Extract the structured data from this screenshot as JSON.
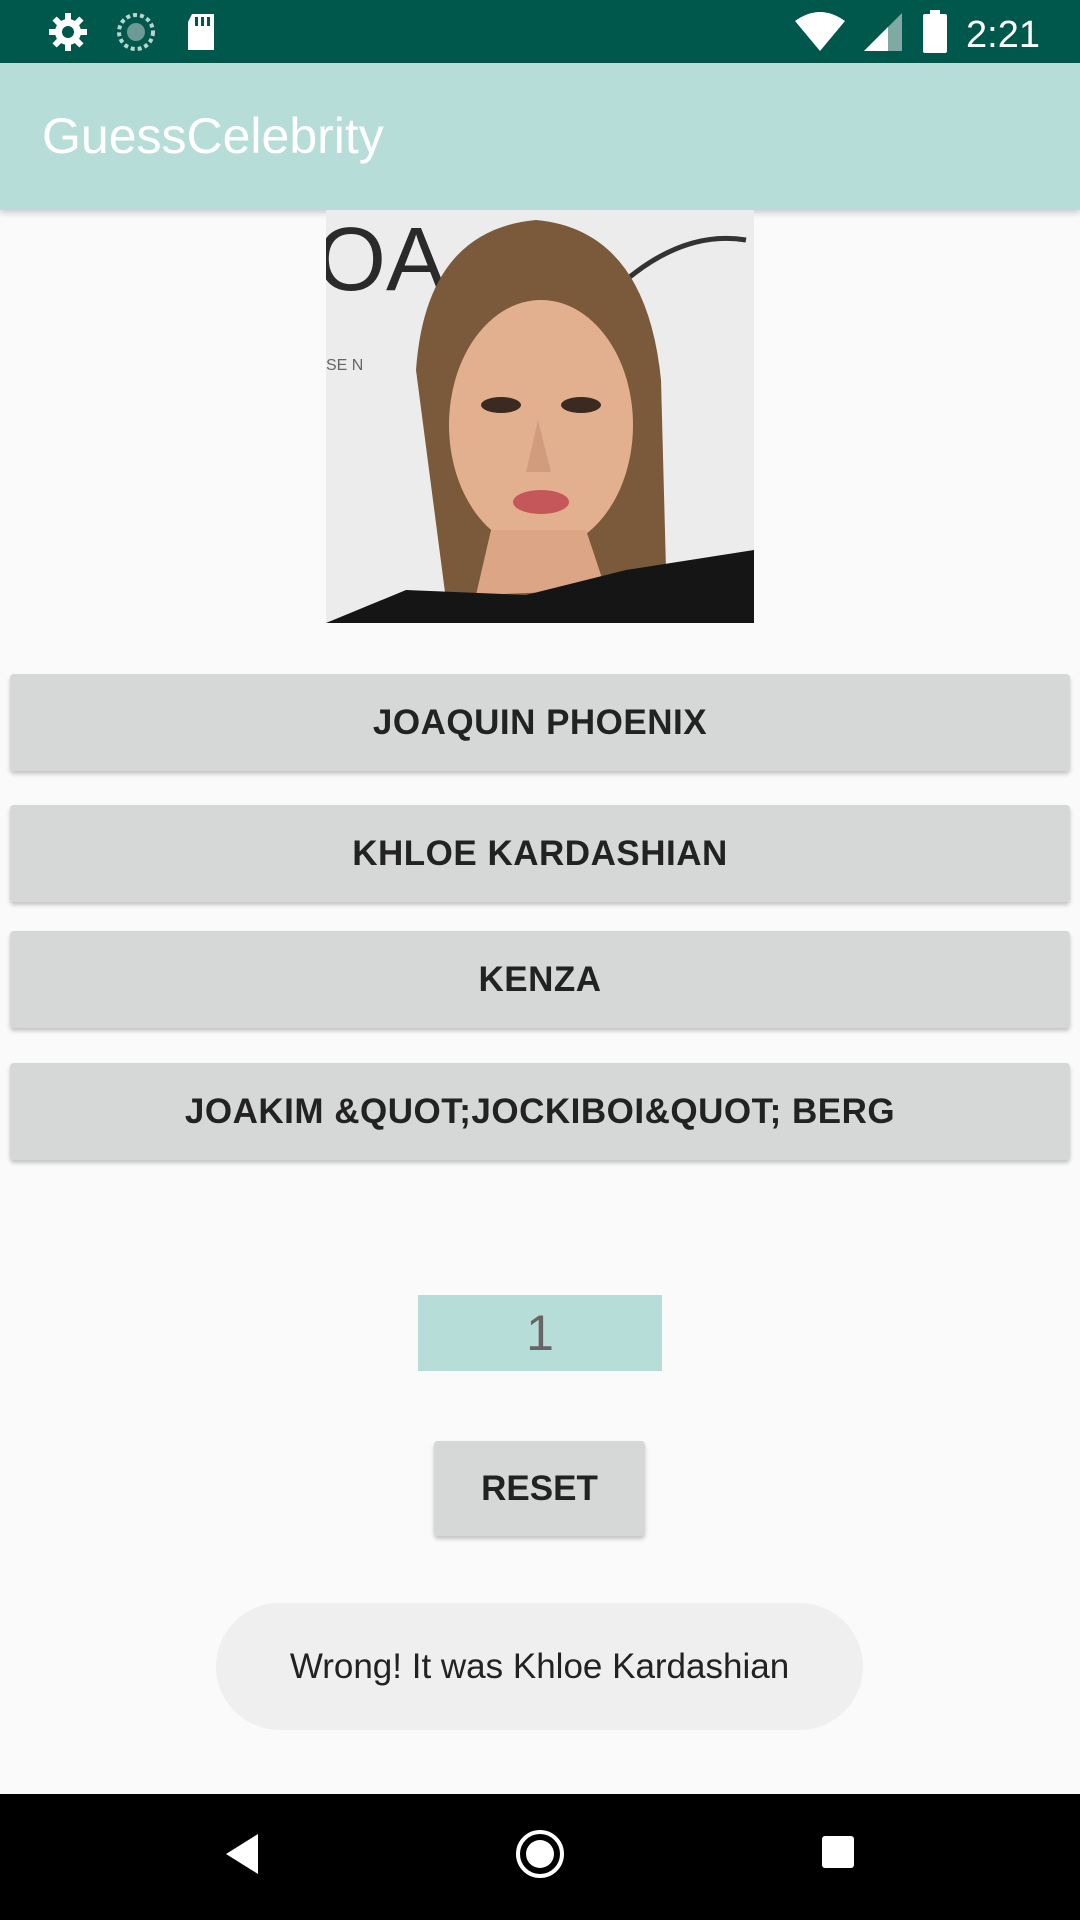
{
  "status_bar": {
    "time": "2:21",
    "left_icons": [
      "gear-icon",
      "sync-icon",
      "sd-card-icon"
    ],
    "right_icons": [
      "wifi-icon",
      "signal-icon",
      "battery-icon"
    ],
    "background": "#00574b"
  },
  "app_bar": {
    "title": "GuessCelebrity",
    "background": "#b7ddd9"
  },
  "answers": [
    {
      "label": "JOAQUIN PHOENIX"
    },
    {
      "label": "KHLOE KARDASHIAN"
    },
    {
      "label": "KENZA"
    },
    {
      "label": "JOAKIM &QUOT;JOCKIBOI&QUOT; BERG"
    }
  ],
  "score": "1",
  "reset_label": "RESET",
  "toast_message": "Wrong! It was Khloe Kardashian",
  "nav_bar": {
    "buttons": [
      "back-icon",
      "home-icon",
      "recents-icon"
    ]
  }
}
